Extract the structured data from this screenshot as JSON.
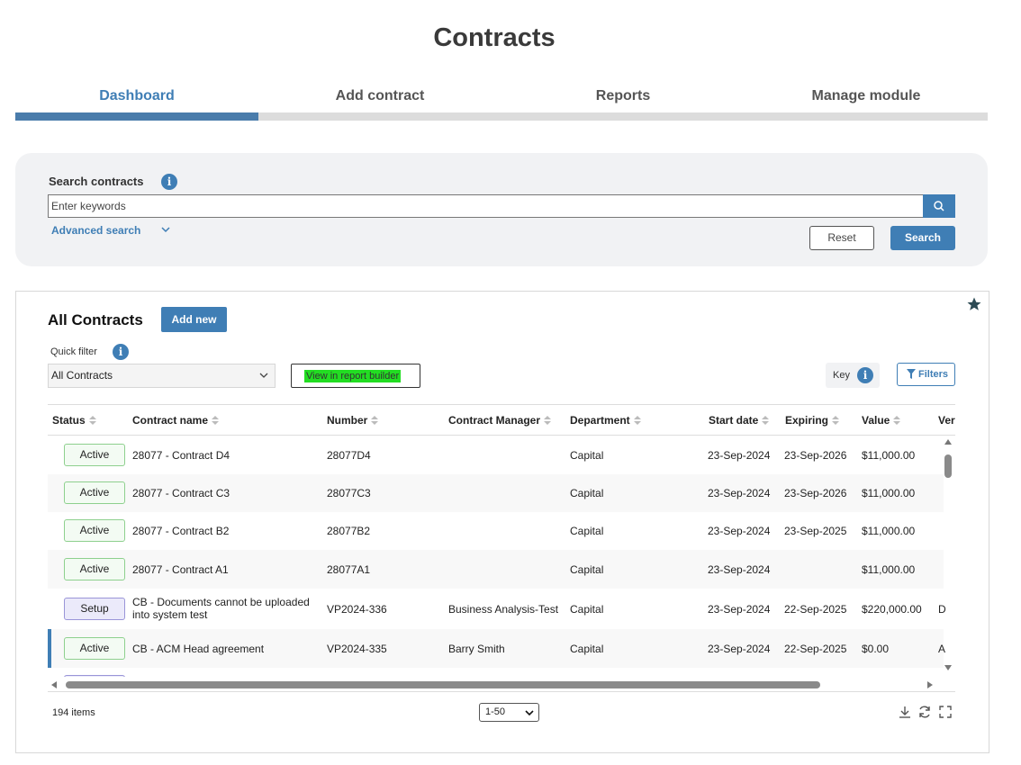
{
  "page": {
    "title": "Contracts"
  },
  "tabs": [
    {
      "label": "Dashboard",
      "active": true
    },
    {
      "label": "Add contract",
      "active": false
    },
    {
      "label": "Reports",
      "active": false
    },
    {
      "label": "Manage module",
      "active": false
    }
  ],
  "search": {
    "label": "Search contracts",
    "placeholder": "Enter keywords",
    "value": "",
    "advanced_label": "Advanced search",
    "reset_label": "Reset",
    "search_label": "Search"
  },
  "contracts": {
    "title": "All Contracts",
    "add_new_label": "Add new",
    "quick_filter_label": "Quick filter",
    "quick_filter_value": "All Contracts",
    "report_builder_label": "View in report builder",
    "key_label": "Key",
    "filters_label": "Filters",
    "columns": [
      "Status",
      "Contract name",
      "Number",
      "Contract Manager",
      "Department",
      "Start date",
      "Expiring",
      "Value",
      "Ver"
    ],
    "rows": [
      {
        "status": "Active",
        "name": "28077 - Contract D4",
        "number": "28077D4",
        "manager": "",
        "department": "Capital",
        "start": "23-Sep-2024",
        "expiring": "23-Sep-2026",
        "value": "$11,000.00",
        "ver": ""
      },
      {
        "status": "Active",
        "name": "28077 - Contract C3",
        "number": "28077C3",
        "manager": "",
        "department": "Capital",
        "start": "23-Sep-2024",
        "expiring": "23-Sep-2026",
        "value": "$11,000.00",
        "ver": ""
      },
      {
        "status": "Active",
        "name": "28077 - Contract B2",
        "number": "28077B2",
        "manager": "",
        "department": "Capital",
        "start": "23-Sep-2024",
        "expiring": "23-Sep-2025",
        "value": "$11,000.00",
        "ver": ""
      },
      {
        "status": "Active",
        "name": "28077 - Contract A1",
        "number": "28077A1",
        "manager": "",
        "department": "Capital",
        "start": "23-Sep-2024",
        "expiring": "",
        "value": "$11,000.00",
        "ver": ""
      },
      {
        "status": "Setup",
        "name_line1": "CB - Documents cannot be uploaded",
        "name_line2": "into system test",
        "number": "VP2024-336",
        "manager": "Business Analysis-Test",
        "department": "Capital",
        "start": "23-Sep-2024",
        "expiring": "22-Sep-2025",
        "value": "$220,000.00",
        "ver": "D"
      },
      {
        "status": "Active",
        "name": "CB - ACM Head agreement",
        "number": "VP2024-335",
        "manager": "Barry Smith",
        "department": "Capital",
        "start": "23-Sep-2024",
        "expiring": "22-Sep-2025",
        "value": "$0.00",
        "ver": "A"
      }
    ],
    "items_count": "194 items",
    "page_range": "1-50"
  },
  "colors": {
    "accent": "#3f7eb5",
    "active_border": "#8ed08e",
    "setup_border": "#9a95d8",
    "highlight": "#22dd22"
  },
  "icons": [
    "info-icon",
    "search-icon",
    "chevron-down-icon",
    "star-icon",
    "filter-icon",
    "download-icon",
    "refresh-icon",
    "fullscreen-icon"
  ]
}
